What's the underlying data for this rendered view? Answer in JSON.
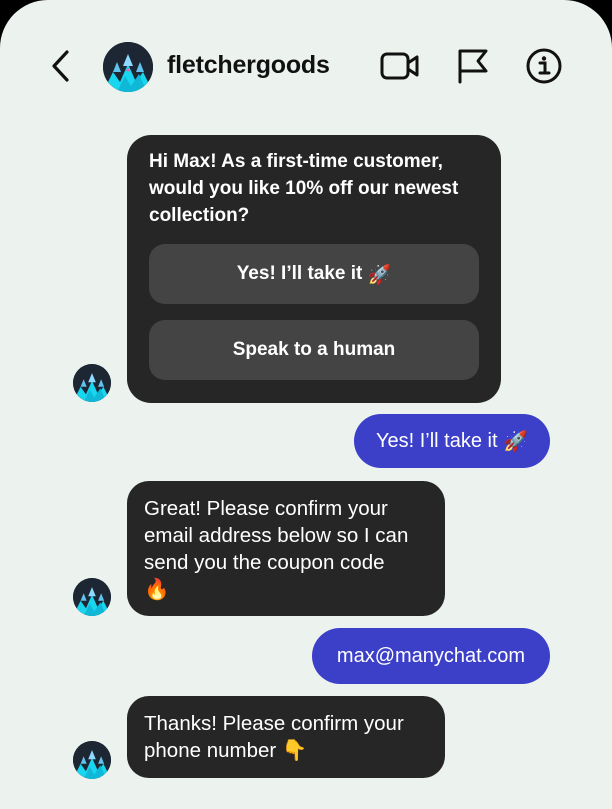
{
  "header": {
    "username": "fletchergoods",
    "icons": [
      "chevron-left-icon",
      "video-camera-icon",
      "flag-icon",
      "info-icon"
    ]
  },
  "messages": [
    {
      "from": "fletchergoods",
      "type": "card",
      "text": "Hi Max! As a first-time customer, would you like 10% off our newest collection?",
      "quick_replies": [
        {
          "label": "Yes! I’ll take it",
          "emoji": "🚀"
        },
        {
          "label": "Speak to a human",
          "emoji": ""
        }
      ]
    },
    {
      "from": "user",
      "text": "Yes! I’ll take it",
      "emoji": "🚀"
    },
    {
      "from": "fletchergoods",
      "text": "Great! Please confirm your email address below so I can send you the coupon code",
      "emoji": "🔥"
    },
    {
      "from": "user",
      "text": "max@manychat.com",
      "emoji": ""
    },
    {
      "from": "fletchergoods",
      "text": "Thanks! Please confirm your phone number",
      "emoji": "👇"
    }
  ],
  "colors": {
    "background": "#ecf3ef",
    "incoming_bubble": "#262626",
    "outgoing_bubble": "#3c3fc8",
    "quick_reply": "#444444"
  }
}
